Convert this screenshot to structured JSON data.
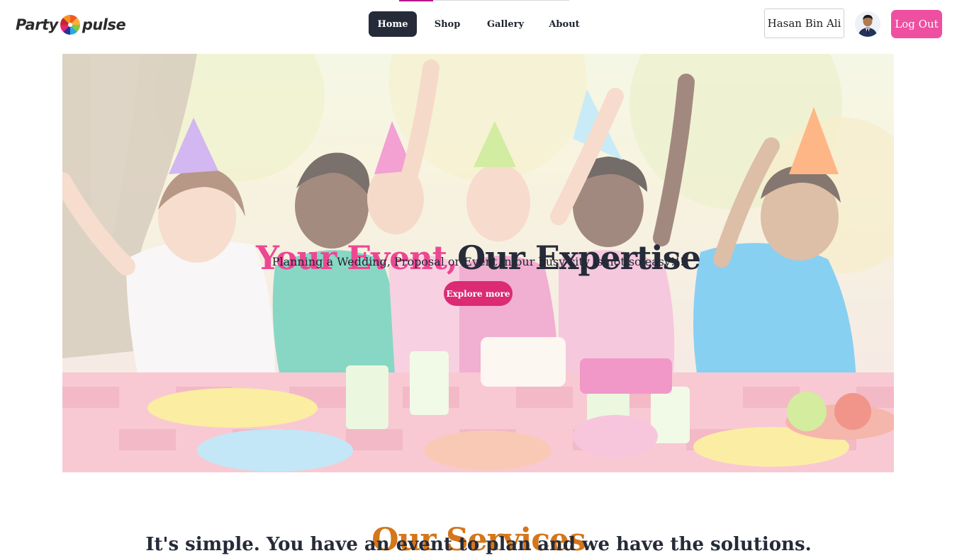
{
  "brand": {
    "logo_left": "Party",
    "logo_right": "pulse",
    "logo_mark_icon": "pinwheel-icon"
  },
  "nav": {
    "items": [
      {
        "label": "Home",
        "active": true
      },
      {
        "label": "Shop",
        "active": false
      },
      {
        "label": "Gallery",
        "active": false
      },
      {
        "label": "About",
        "active": false
      }
    ]
  },
  "user": {
    "name": "Hasan Bin Ali",
    "avatar_icon": "user-avatar",
    "logout_label": "Log Out"
  },
  "hero": {
    "title_accent": "Your Event,",
    "title_main": "Our Expertise",
    "subtitle": "Planning a Wedding, Proposal or Event in our busy city is not so easy!!!",
    "cta_label": "Explore more",
    "image_subject": "children-birthday-party-photo"
  },
  "services": {
    "title": "Our Services",
    "subtitle": "It's simple. You have an event to plan and we have the solutions."
  },
  "colors": {
    "accent_pink": "#ec4892",
    "button_pink": "#dc2a73",
    "logout_pink": "#ee4fa0",
    "nav_active_bg": "#262b39",
    "services_orange": "#d4761a",
    "text_dark": "#262b39"
  }
}
